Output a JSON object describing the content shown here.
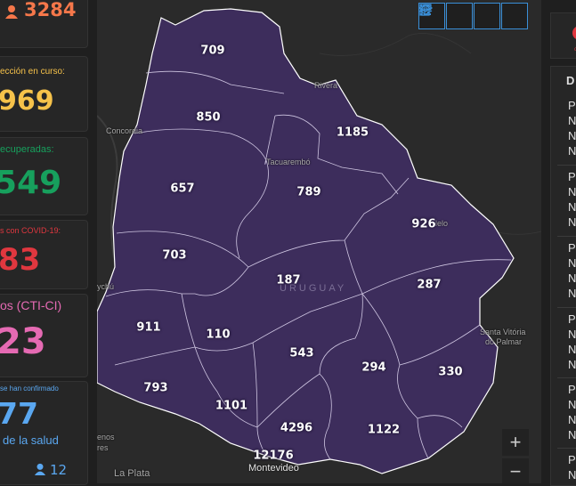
{
  "stats": {
    "total": "3284",
    "active_label": "ección en curso:",
    "active_value": "969",
    "recovered_label": "ecuperadas:",
    "recovered_value": "549",
    "deaths_label": "s con COVID-19:",
    "deaths_value": "83",
    "icu_label": "os (CTI-CI)",
    "icu_value": "23",
    "health_label_top": "se han confirmado",
    "health_value": "77",
    "health_label_bottom": "de la salud",
    "health_sub_value": "12"
  },
  "colors": {
    "orange": "#f5774a",
    "yellow": "#f6c24a",
    "green": "#17a05d",
    "red": "#e0373f",
    "pink": "#e56ab3",
    "blue": "#5aa7f0",
    "region": "#3d2d5c"
  },
  "map": {
    "country": "URUGUAY",
    "places": [
      "Rivera",
      "Concordia",
      "Tacuarembó",
      "lelo",
      "ychú",
      "Santa Vitória",
      "do Palmar",
      "enos",
      "res",
      "La Plata",
      "Montevideo"
    ],
    "departments": [
      {
        "name": "artigas",
        "value": "709"
      },
      {
        "name": "salto",
        "value": "850"
      },
      {
        "name": "rivera",
        "value": "1185"
      },
      {
        "name": "paysandu",
        "value": "657"
      },
      {
        "name": "tacuarembo",
        "value": "789"
      },
      {
        "name": "cerro-largo",
        "value": "926"
      },
      {
        "name": "rio-negro",
        "value": "703"
      },
      {
        "name": "durazno",
        "value": "187"
      },
      {
        "name": "treinta-y-tres",
        "value": "287"
      },
      {
        "name": "soriano",
        "value": "911"
      },
      {
        "name": "flores",
        "value": "110"
      },
      {
        "name": "florida",
        "value": "543"
      },
      {
        "name": "lavalleja",
        "value": "294"
      },
      {
        "name": "rocha",
        "value": "330"
      },
      {
        "name": "colonia",
        "value": "793"
      },
      {
        "name": "san-jose",
        "value": "1101"
      },
      {
        "name": "canelones",
        "value": "4296"
      },
      {
        "name": "maldonado",
        "value": "1122"
      },
      {
        "name": "montevideo",
        "value": "12176"
      }
    ]
  },
  "toolbar": {
    "icons": [
      "home-icon",
      "list-icon",
      "layers-icon",
      "qr-icon"
    ]
  },
  "zoom": {
    "in": "+",
    "out": "−"
  },
  "right_panel": {
    "header": "D",
    "lines": [
      "Pa",
      "N",
      "N",
      "N",
      "Pa",
      "N",
      "N",
      "N",
      "Pa",
      "N",
      "N",
      "N",
      "Pa",
      "N",
      "N",
      "N",
      "Pa",
      "N",
      "N",
      "N",
      "Pa",
      "N"
    ],
    "dot_label": "c"
  }
}
